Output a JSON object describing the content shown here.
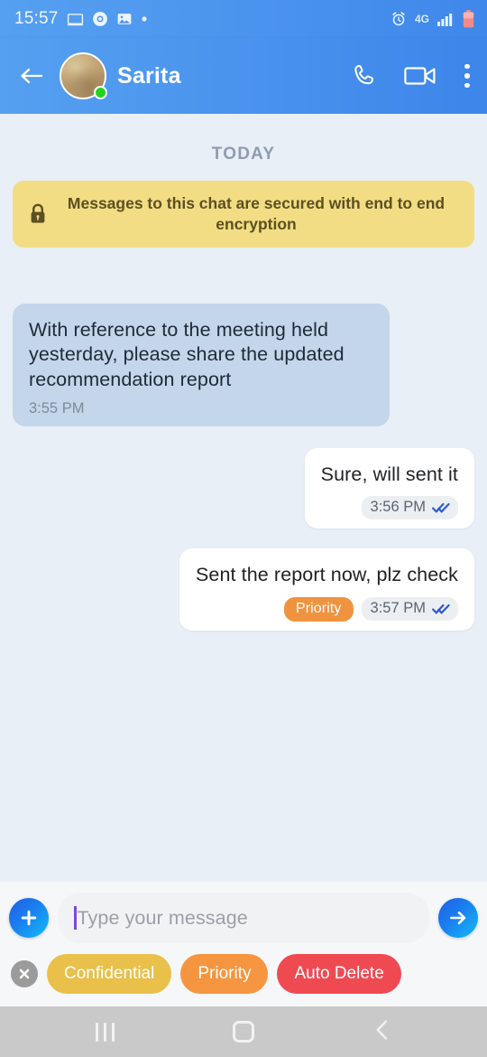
{
  "statusbar": {
    "time": "15:57",
    "left_icons": [
      "screencast-icon",
      "chrome-icon",
      "gallery-icon",
      "dot-icon"
    ],
    "right_icons": [
      "alarm-icon",
      "network-4g-icon",
      "signal-bars-icon",
      "battery-low-icon"
    ],
    "network_label": "4G"
  },
  "appbar": {
    "back_icon": "back-arrow-icon",
    "contact_name": "Sarita",
    "online": true,
    "actions": [
      "voice-call-icon",
      "video-call-icon",
      "overflow-menu-icon"
    ]
  },
  "chat": {
    "date_divider": "TODAY",
    "encryption_notice": "Messages to this chat are secured with end to end encryption",
    "encryption_icon": "lock-icon",
    "messages": [
      {
        "direction": "incoming",
        "text": "With reference to the meeting held yesterday, please share the updated recommendation report",
        "time": "3:55 PM",
        "tag": null,
        "receipt": null
      },
      {
        "direction": "outgoing",
        "text": "Sure, will sent it",
        "time": "3:56 PM",
        "tag": null,
        "receipt": "double-check-read-icon"
      },
      {
        "direction": "outgoing",
        "text": "Sent the report now, plz check",
        "time": "3:57 PM",
        "tag": "Priority",
        "tag_color": "#f0933f",
        "receipt": "double-check-read-icon"
      }
    ]
  },
  "composer": {
    "add_button_icon": "plus-icon",
    "input_value": "",
    "input_placeholder": "Type your message",
    "send_button_icon": "send-arrow-icon"
  },
  "tagbar": {
    "close_icon": "close-circle-icon",
    "chips": [
      {
        "label": "Confidential",
        "color": "#e8c04a"
      },
      {
        "label": "Priority",
        "color": "#f5953f"
      },
      {
        "label": "Auto Delete",
        "color": "#ef4a52"
      }
    ]
  },
  "navbar": {
    "recents_icon": "recents-icon",
    "home_icon": "home-icon",
    "back_icon": "nav-back-icon"
  },
  "colors": {
    "header_blue": "#4a93ee",
    "chat_background": "#e9eff6",
    "incoming_bubble": "#c4d6ea",
    "outgoing_bubble": "#ffffff",
    "encryption_banner": "#f2dd84",
    "online_green": "#22d21e",
    "receipt_blue": "#2f5ad0",
    "accent_send": "#1a7ff0"
  }
}
